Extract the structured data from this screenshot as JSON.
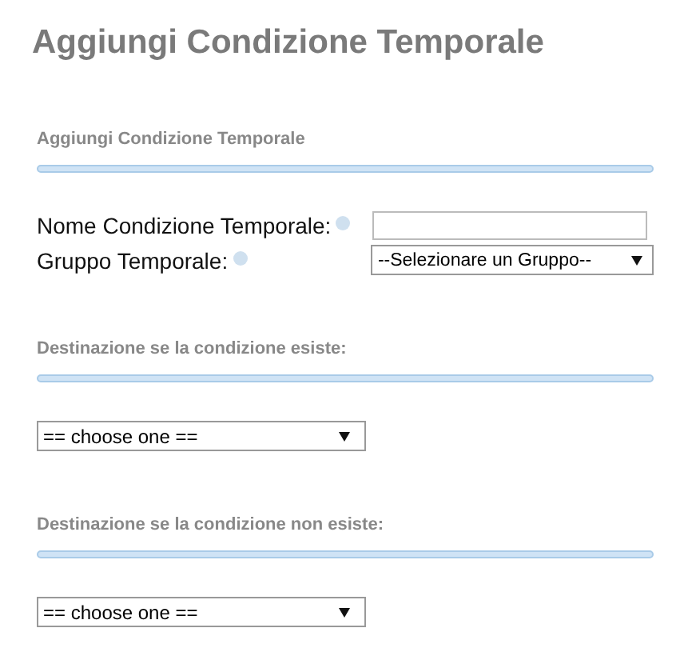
{
  "title": "Aggiungi Condizione Temporale",
  "sections": [
    {
      "heading": "Aggiungi Condizione Temporale",
      "fields": [
        {
          "kind": "text",
          "label": "Nome Condizione Temporale:",
          "help": true
        },
        {
          "kind": "select",
          "label": "Gruppo Temporale:",
          "help": true,
          "value": "--Selezionare un Gruppo--"
        }
      ]
    },
    {
      "heading": "Destinazione se la condizione esiste:",
      "fields": [
        {
          "kind": "select",
          "value": "== choose one =="
        }
      ]
    },
    {
      "heading": "Destinazione se la condizione non esiste:",
      "fields": [
        {
          "kind": "select",
          "value": "== choose one =="
        }
      ]
    }
  ]
}
